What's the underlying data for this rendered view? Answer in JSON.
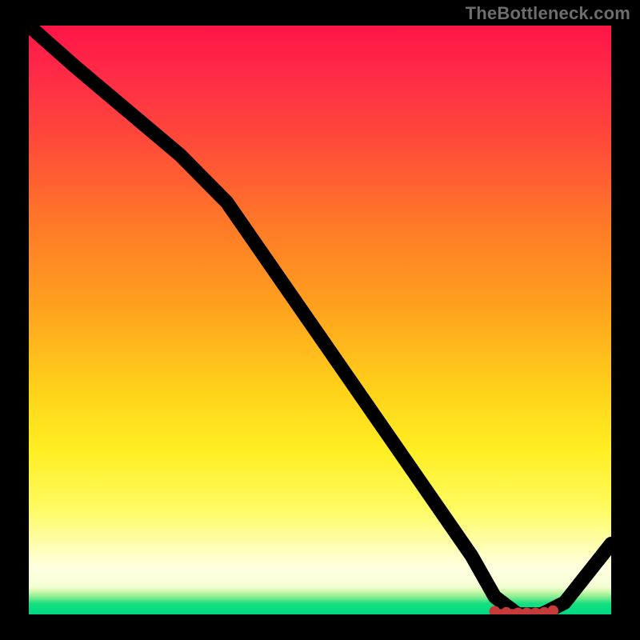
{
  "attribution": "TheBottleneck.com",
  "chart_data": {
    "type": "line",
    "title": "",
    "xlabel": "",
    "ylabel": "",
    "xlim": [
      0,
      100
    ],
    "ylim": [
      0,
      100
    ],
    "series": [
      {
        "name": "curve",
        "x": [
          0,
          8,
          26,
          34,
          48,
          62,
          76,
          80,
          84,
          86,
          88,
          92,
          100
        ],
        "values": [
          100,
          93,
          78,
          70,
          50,
          30,
          10,
          3,
          0,
          0,
          0,
          2,
          12
        ]
      }
    ],
    "markers": {
      "name": "highlight",
      "x": [
        80,
        82,
        84,
        85.5,
        87,
        88.5,
        90
      ],
      "values": [
        0.5,
        0.3,
        0.2,
        0.2,
        0.2,
        0.3,
        0.6
      ]
    },
    "gradient_stops": [
      {
        "pos": 0.0,
        "color": "#ff1547"
      },
      {
        "pos": 0.35,
        "color": "#ff7a28"
      },
      {
        "pos": 0.65,
        "color": "#ffd21a"
      },
      {
        "pos": 0.9,
        "color": "#ffffe0"
      },
      {
        "pos": 1.0,
        "color": "#00d884"
      }
    ]
  }
}
